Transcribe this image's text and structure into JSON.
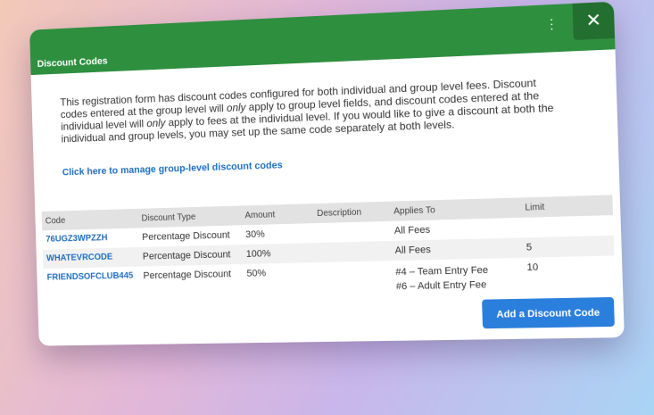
{
  "modal": {
    "title": "Discount Codes",
    "close_label": "✕",
    "more_label": "⋮"
  },
  "intro": {
    "part1": "This registration form has discount codes configured for both individual and group level fees. Discount codes entered at the group level will ",
    "emph1": "only",
    "part2": " apply to group level fields, and discount codes entered at the individual level will ",
    "emph2": "only",
    "part3": " apply to fees at the individual level. If you would like to give a discount at both the inidividual and group levels, you may set up the same code separately at both levels."
  },
  "manage_link": "Click here to manage group-level discount codes",
  "table": {
    "headers": {
      "code": "Code",
      "type": "Discount Type",
      "amount": "Amount",
      "description": "Description",
      "applies": "Applies To",
      "limit": "Limit"
    },
    "rows": [
      {
        "code": "76UGZ3WPZZH",
        "type": "Percentage Discount",
        "amount": "30%",
        "description": "",
        "applies": [
          "All Fees"
        ],
        "limit": ""
      },
      {
        "code": "WHATEVRCODE",
        "type": "Percentage Discount",
        "amount": "100%",
        "description": "",
        "applies": [
          "All Fees"
        ],
        "limit": "5"
      },
      {
        "code": "FRIENDSOFCLUB445",
        "type": "Percentage Discount",
        "amount": "50%",
        "description": "",
        "applies": [
          "#4 – Team Entry Fee",
          "#6 – Adult Entry Fee"
        ],
        "limit": "10"
      }
    ]
  },
  "add_button": "Add a Discount Code",
  "colors": {
    "header_green": "#2e8f3f",
    "close_green": "#236f30",
    "link_blue": "#1e6fc0",
    "button_blue": "#2b7fdc"
  },
  "icons": {
    "close": "close-icon",
    "more": "kebab-menu-icon"
  }
}
